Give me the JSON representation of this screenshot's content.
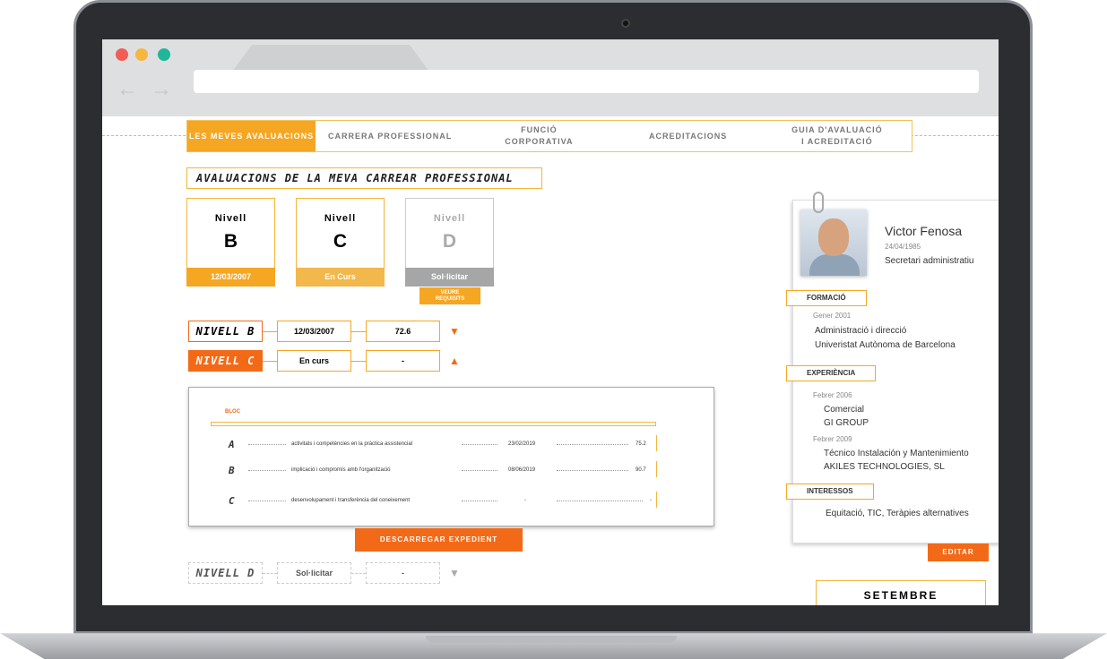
{
  "nav": {
    "tabs": [
      {
        "label": "LES MEVES AVALUACIONS"
      },
      {
        "label": "CARRERA PROFESSIONAL"
      },
      {
        "label": "FUNCIÓ\nCORPORATIVA"
      },
      {
        "label": "ACREDITACIONS"
      },
      {
        "label": "GUIA D'AVALUACIÓ\nI ACREDITACIÓ"
      }
    ]
  },
  "section_title": "AVALUACIONS DE LA MEVA CARREAR PROFESSIONAL",
  "cards": [
    {
      "label": "Nivell",
      "letter": "B",
      "footer": "12/03/2007",
      "color": "#f5a623"
    },
    {
      "label": "Nivell",
      "letter": "C",
      "footer": "En Curs",
      "color": "#f2b84b"
    },
    {
      "label": "Nivell",
      "letter": "D",
      "footer": "Sol·licitar",
      "color": "#a6a6a6"
    }
  ],
  "requirements_button": "VEURE\nREQUISITS",
  "levels": [
    {
      "name": "NIVELL B",
      "status": "12/03/2007",
      "score": "72.6"
    },
    {
      "name": "NIVELL C",
      "status": "En curs",
      "score": "-"
    },
    {
      "name": "NIVELL D",
      "status": "Sol·licitar",
      "score": "-"
    }
  ],
  "panel": {
    "heading": "BLOC",
    "rows": [
      {
        "letter": "A",
        "text": "activitats i competències en la pràctica assistencial",
        "date": "23/02/2019",
        "score": "75.2"
      },
      {
        "letter": "B",
        "text": "implicació i compromís amb l'organització",
        "date": "08/06/2019",
        "score": "90.7"
      },
      {
        "letter": "C",
        "text": "desenvolupament i transferència del coneixement",
        "date": "-",
        "score": "-"
      }
    ]
  },
  "download_button": "DESCARREGAR EXPEDIENT",
  "profile": {
    "name": "Victor Fenosa",
    "birthdate": "24/04/1985",
    "role": "Secretari administratiu",
    "formacio_label": "FORMACIÓ",
    "formacio_date": "Gener 2001",
    "formacio_title": "Administració i direcció",
    "formacio_school": "Univeristat Autònoma de Barcelona",
    "experiencia_label": "EXPERIÈNCIA",
    "exp1_date": "Febrer 2006",
    "exp1_role": "Comercial",
    "exp1_company": "GI GROUP",
    "exp2_date": "Febrer 2009",
    "exp2_role": "Técnico Instalación y Mantenimiento",
    "exp2_company": "AKILES TECHNOLOGIES, SL",
    "interessos_label": "INTERESSOS",
    "interessos": "Equitació, TIC, Teràpies alternatives"
  },
  "edit_button": "EDITAR",
  "calendar_month": "SETEMBRE"
}
